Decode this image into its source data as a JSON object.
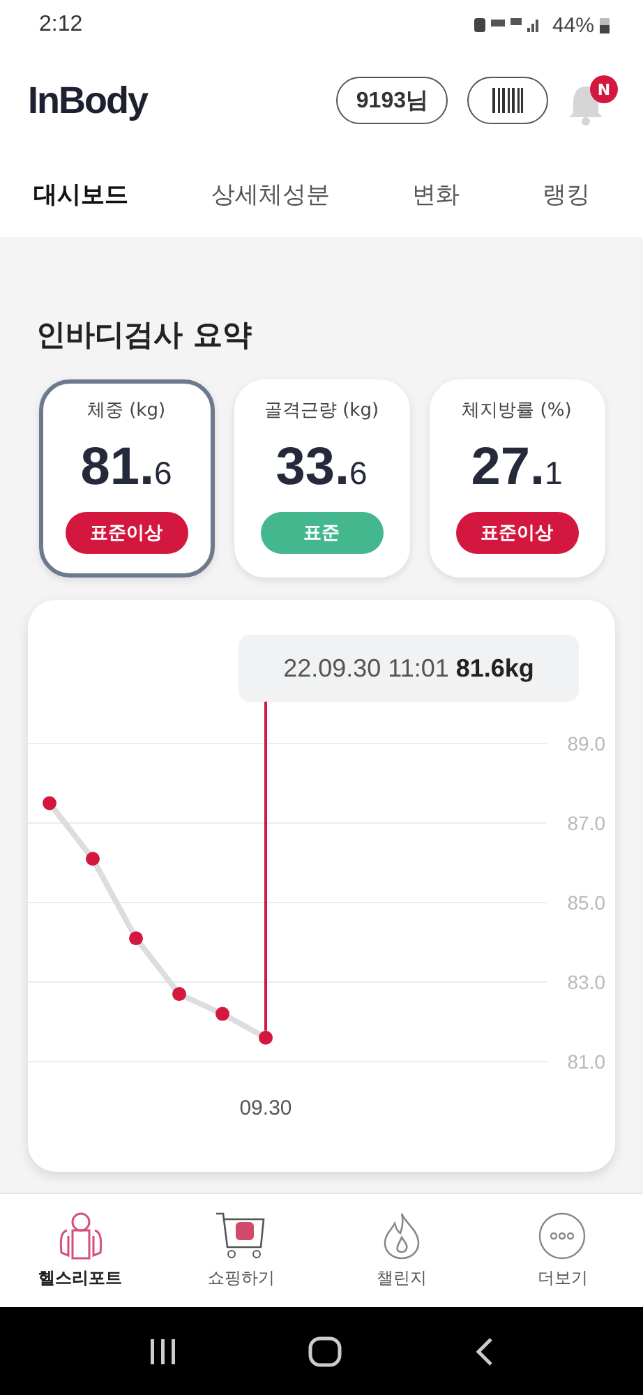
{
  "status_bar": {
    "time": "2:12",
    "battery": "44%"
  },
  "header": {
    "logo": "InBody",
    "user": "9193님",
    "bell_badge": "N"
  },
  "tabs": [
    {
      "label": "대시보드",
      "selected": true
    },
    {
      "label": "상세체성분",
      "selected": false
    },
    {
      "label": "변화",
      "selected": false
    },
    {
      "label": "랭킹",
      "selected": false
    }
  ],
  "section_title": "인바디검사 요약",
  "metrics": [
    {
      "label": "체중 (kg)",
      "value": "81.",
      "decimal": "6",
      "status": "표준이상",
      "color": "#d4173f",
      "selected": true
    },
    {
      "label": "골격근량 (kg)",
      "value": "33.",
      "decimal": "6",
      "status": "표준",
      "color": "#45b78e",
      "selected": false
    },
    {
      "label": "체지방률 (%)",
      "value": "27.",
      "decimal": "1",
      "status": "표준이상",
      "color": "#d4173f",
      "selected": false
    }
  ],
  "chart": {
    "tooltip": "22.09.30 11:01 **81.6kg**",
    "chart_data": {
      "type": "line",
      "grid": true,
      "categories": [
        null,
        null,
        null,
        null,
        null,
        "09.30",
        null,
        null,
        null,
        null,
        null,
        null
      ],
      "series": [
        {
          "color": "#dcdde0",
          "marker": "circle",
          "values": [
            87.5,
            86.1,
            84.1,
            82.7,
            82.2,
            81.6,
            null,
            null,
            null,
            null,
            null,
            null
          ]
        }
      ],
      "ylim": [
        81,
        89
      ],
      "yticks": [
        {
          "value": 89,
          "label": "89.0"
        },
        {
          "value": 87,
          "label": "87.0"
        },
        {
          "value": 85,
          "label": "85.0"
        },
        {
          "value": 83,
          "label": "83.0"
        },
        {
          "value": 81,
          "label": "81.0"
        }
      ]
    }
  },
  "bottom_nav": [
    {
      "label": "헬스리포트",
      "kind": "report",
      "selected": true
    },
    {
      "label": "쇼핑하기",
      "kind": "shop",
      "selected": false
    },
    {
      "label": "챌린지",
      "kind": "challenge",
      "selected": false
    },
    {
      "label": "더보기",
      "kind": "more",
      "selected": false
    }
  ]
}
